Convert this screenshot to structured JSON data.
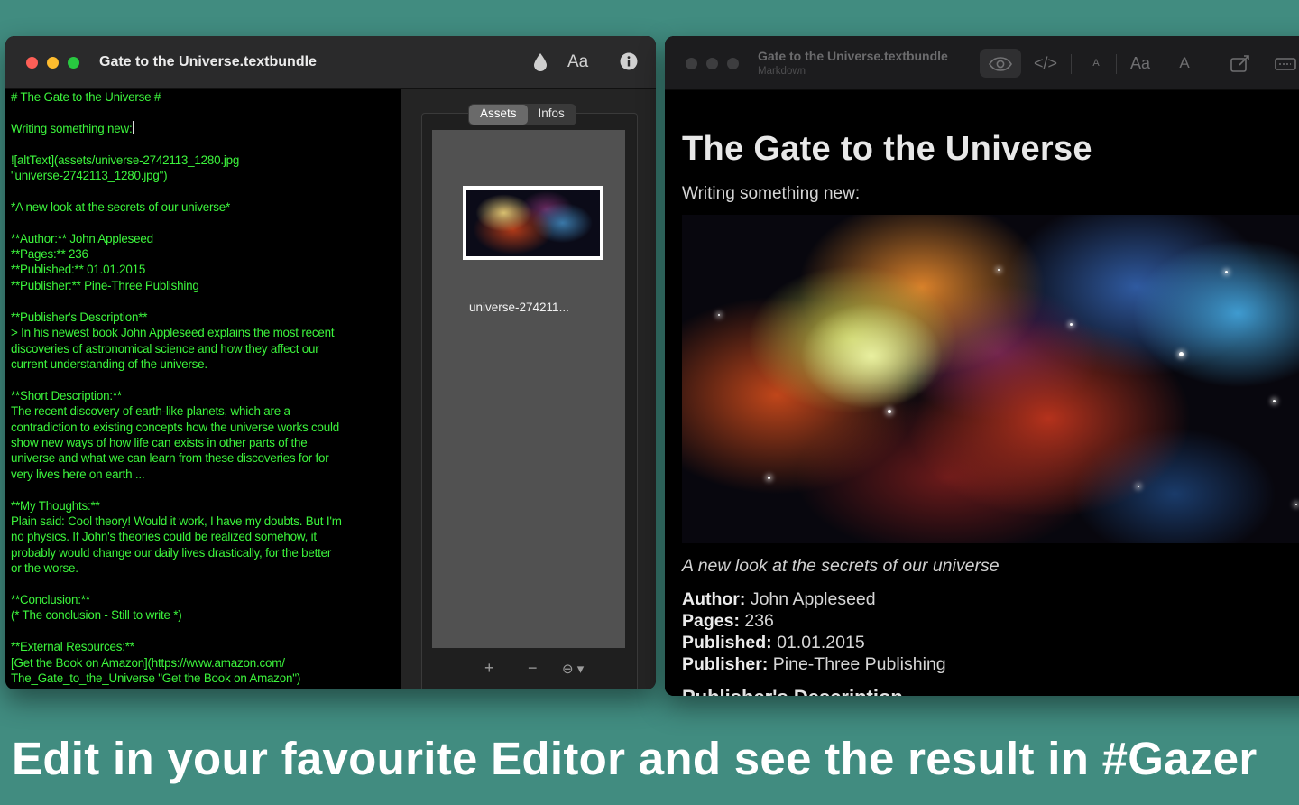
{
  "editor_window": {
    "title": "Gate to the Universe.textbundle",
    "font_button": "Aa",
    "markdown_lines": [
      "# The Gate to the Universe #",
      "",
      "Writing something new:",
      "",
      "![altText](assets/universe-2742113_1280.jpg",
      "\"universe-2742113_1280.jpg\")",
      "",
      "*A new look at the secrets of our universe*",
      "",
      "**Author:** John Appleseed",
      "**Pages:** 236",
      "**Published:** 01.01.2015",
      "**Publisher:** Pine-Three Publishing",
      "",
      "**Publisher's Description**",
      "> In his newest book John Appleseed explains the most recent",
      "discoveries of astronomical science and how they affect our",
      "current understanding of the universe.",
      "",
      "**Short Description:**",
      "The recent discovery of earth-like planets, which are a",
      "contradiction to existing concepts how the universe works could",
      "show new ways of how life can exists in other parts of the",
      "universe and what we can learn from these discoveries for for",
      "very lives here on earth ...",
      "",
      "**My Thoughts:**",
      "Plain said: Cool theory! Would it work, I have my doubts. But I'm",
      "no physics. If John's theories could be realized somehow, it",
      "probably would change our daily lives drastically, for the better",
      "or the worse.",
      "",
      "**Conclusion:**",
      "(* The conclusion - Still to write *)",
      "",
      "**External Resources:**",
      "[Get the Book on Amazon](https://www.amazon.com/",
      "The_Gate_to_the_Universe \"Get the Book on Amazon\")"
    ],
    "sidebar": {
      "tabs": [
        "Assets",
        "Infos"
      ],
      "active_tab": "Assets",
      "asset_name": "universe-274211...",
      "add_symbol": "+",
      "remove_symbol": "−",
      "more_symbol": "⊖ ▾"
    }
  },
  "gazer_window": {
    "title": "Gate to the Universe.textbundle",
    "subtitle": "Markdown",
    "toolbar": {
      "code_symbol": "</>",
      "small_a": "A",
      "font_button": "Aa",
      "large_a": "A"
    },
    "preview": {
      "heading": "The Gate to the Universe",
      "intro": "Writing something new:",
      "emphasis": "A new look at the secrets of our universe",
      "meta": [
        {
          "label": "Author:",
          "value": " John Appleseed"
        },
        {
          "label": "Pages:",
          "value": " 236"
        },
        {
          "label": "Published:",
          "value": " 01.01.2015"
        },
        {
          "label": "Publisher:",
          "value": " Pine-Three Publishing"
        }
      ],
      "next_heading": "Publisher's Description"
    }
  },
  "caption": "Edit in your favourite Editor and see the result in #Gazer",
  "colors": {
    "background": "#418c80",
    "editor_text": "#3cf53c",
    "close": "#fe5f57",
    "minimize": "#febc2e",
    "zoom": "#28c840"
  }
}
